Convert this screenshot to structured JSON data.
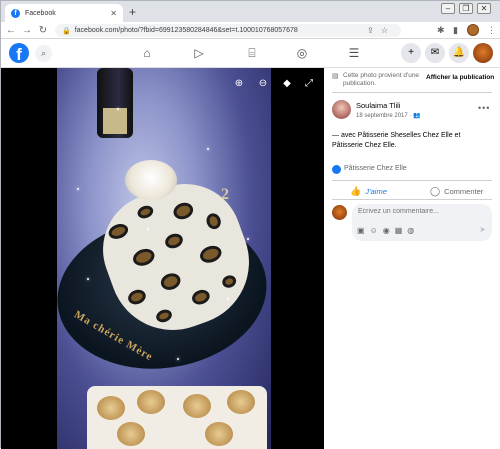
{
  "browser": {
    "tab_title": "Facebook",
    "tab_close": "✕",
    "new_tab": "+",
    "url": "facebook.com/photo/?fbid=699123580284846&set=t.100010768057678",
    "window_controls": [
      "–",
      "❐",
      "✕"
    ]
  },
  "photo": {
    "plate_text": "Ma chérie Mère",
    "candle_text": "2"
  },
  "panel": {
    "notice": "Cette photo provient d'une publication.",
    "show_publication": "Afficher la publication",
    "author_name": "Soulaima Tlili",
    "author_date": "18 septembre 2017 · ",
    "caption": "— avec Pâtisserie Sheselles Chez Elle et Pâtisserie Chez Elle.",
    "page_link": "Pâtisserie Chez Elle",
    "like_label": "J’aime",
    "comment_label": "Commenter",
    "comment_placeholder": "Écrivez un commentaire..."
  },
  "colors": {
    "brand": "#1877f2",
    "text": "#050505",
    "muted": "#65676b",
    "photo_bg": "#000000"
  },
  "icons": {
    "nav": [
      "home-icon",
      "video-icon",
      "marketplace-icon",
      "groups-icon",
      "menu-icon"
    ],
    "right": [
      "create-icon",
      "messenger-icon",
      "notifications-icon",
      "account-icon"
    ],
    "photo_controls": [
      "zoom-in-icon",
      "zoom-out-icon",
      "tag-icon",
      "fullscreen-icon"
    ]
  }
}
